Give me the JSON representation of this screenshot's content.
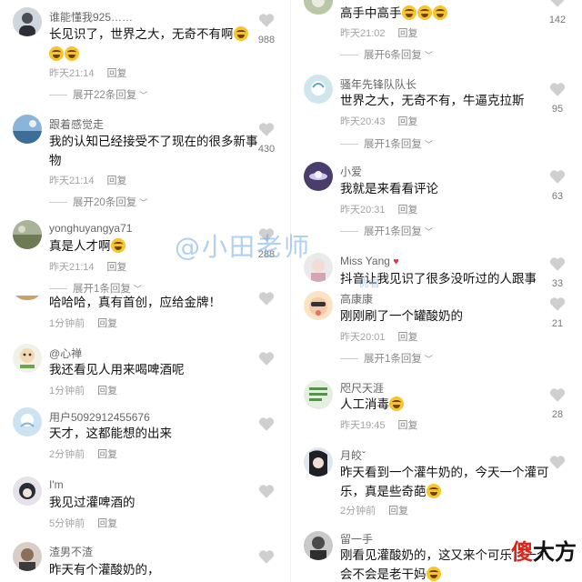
{
  "colors": {
    "accent": "#f7c52b",
    "muted": "#a3a3a3",
    "watermark": "#6eaae6",
    "brand_red": "#d9261c"
  },
  "left": [
    {
      "user": "谁能懂我925……",
      "text": "长见识了，世界之大，无奇不有啊",
      "emoji": "laughing-tears-icon",
      "time": "昨天21:14",
      "reply": "回复",
      "expand": "展开22条回复",
      "likes": "988"
    },
    {
      "user": "跟着感觉走",
      "text": "我的认知已经接受不了现在的很多新事物",
      "time": "昨天21:14",
      "reply": "回复",
      "expand": "展开20条回复",
      "likes": "430"
    },
    {
      "user": "yonghuyangya71",
      "text": "真是人才啊",
      "emoji": "laughing-tears-icon",
      "time": "昨天21:14",
      "reply": "回复",
      "expand": "展开1条回复",
      "likes": "288"
    },
    {
      "user": "",
      "text": "哈哈哈，真有首创，应给金牌！",
      "time": "1分钟前",
      "reply": "回复",
      "likes": ""
    },
    {
      "user": "@心禅",
      "text": "我还看见人用来喝啤酒呢",
      "time": "1分钟前",
      "reply": "回复",
      "likes": ""
    },
    {
      "user": "用户5092912455676",
      "text": "天才，这都能想的出来",
      "time": "2分钟前",
      "reply": "回复",
      "likes": ""
    },
    {
      "user": "I'm",
      "text": "我见过灌啤酒的",
      "time": "5分钟前",
      "reply": "回复",
      "likes": ""
    },
    {
      "user": "渣男不渣",
      "text": "昨天有个灌酸奶的，",
      "likes": ""
    }
  ],
  "right": [
    {
      "user": "",
      "text": "高手中高手",
      "emoji": "laughing-tears-icon",
      "time": "昨天21:02",
      "reply": "回复",
      "expand": "展开6条回复",
      "likes": "142"
    },
    {
      "user": "骚年先锋队队长",
      "text": "世界之大，无奇不有，牛逼克拉斯",
      "time": "昨天20:43",
      "reply": "回复",
      "expand": "展开1条回复",
      "likes": "95"
    },
    {
      "user": "小爱",
      "text": "我就是来看看评论",
      "time": "昨天20:31",
      "reply": "回复",
      "expand": "展开1条回复",
      "likes": "63"
    },
    {
      "user": "Miss  Yang",
      "text": "抖音让我见识了很多没听过的人跟事",
      "likes": "33"
    },
    {
      "user": "高康康",
      "text": "刚刚刷了一个罐酸奶的",
      "time": "昨天20:01",
      "reply": "回复",
      "expand": "展开1条回复",
      "likes": "21"
    },
    {
      "user": "咫尺天涯",
      "text": "人工消毒",
      "emoji": "laughing-tears-icon",
      "time": "昨天19:45",
      "reply": "回复",
      "likes": "28"
    },
    {
      "user": "月皎ˇ",
      "text": "昨天看到一个灌牛奶的，今天一个灌可乐，真是些奇葩",
      "emoji": "laughing-tears-icon",
      "time": "2分钟前",
      "reply": "回复",
      "likes": ""
    },
    {
      "user": "留一手",
      "text": "刚看见灌酸奶的，这又来个可乐，一个会不会是老干妈",
      "likes": ""
    }
  ],
  "watermark": "@小田老师",
  "watermark_sub": "优看",
  "brand": {
    "part1": "傻",
    "part2": "大方"
  }
}
